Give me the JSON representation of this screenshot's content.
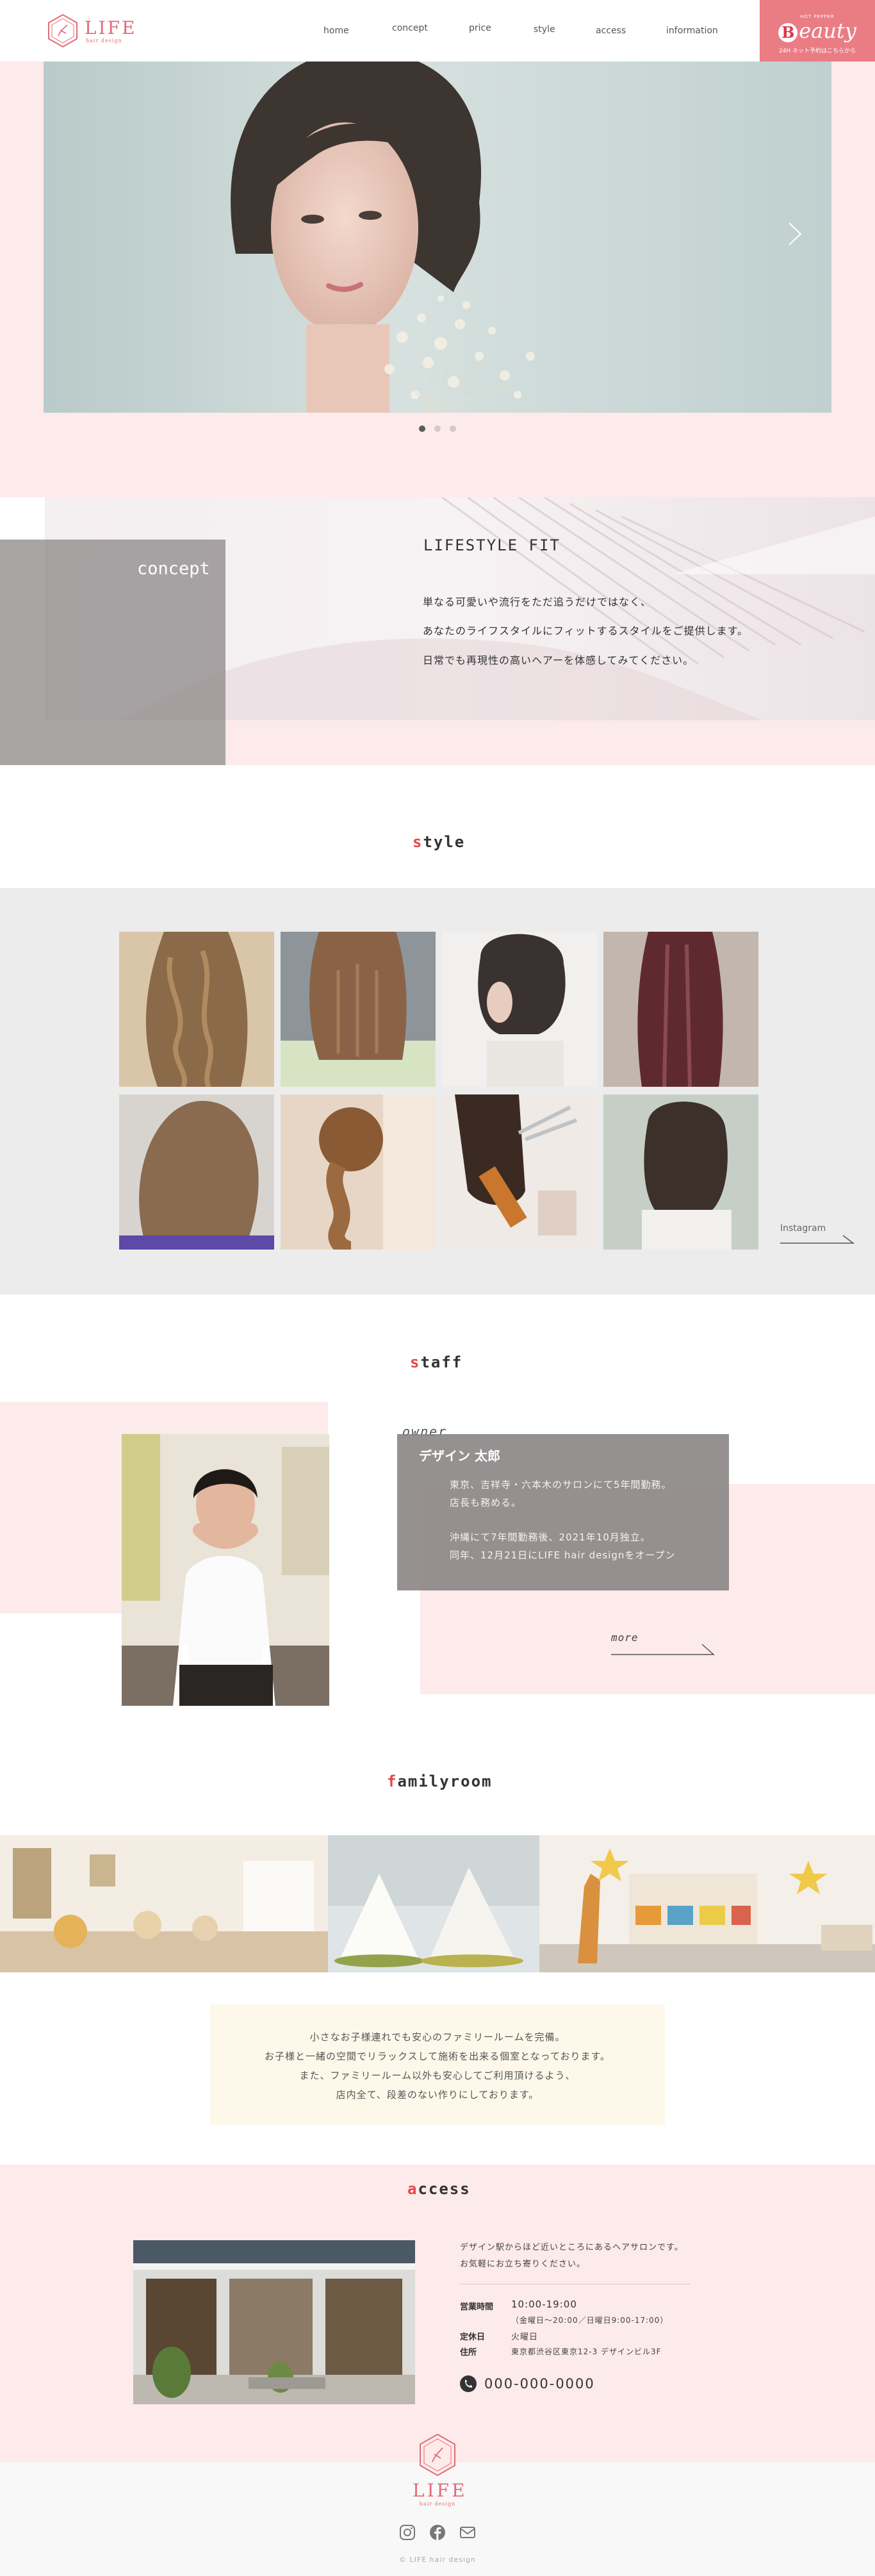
{
  "header": {
    "brand": "LIFE",
    "brand_sub": "hair design",
    "nav": [
      "home",
      "concept",
      "price",
      "style",
      "access",
      "information"
    ],
    "beauty_top": "HOT PEPPER",
    "beauty_label": "eauty",
    "beauty_letter": "B",
    "beauty_sub": "24H ネット予約はこちらから"
  },
  "hero": {
    "slide_count": 3,
    "active_slide": 1
  },
  "concept": {
    "label": "concept",
    "heading": "LIFESTYLE FIT",
    "lines": [
      "単なる可愛いや流行をただ追うだけではなく、",
      "あなたのライフスタイルにフィットするスタイルをご提供します。",
      "日常でも再現性の高いヘアーを体感してみてください。"
    ]
  },
  "style": {
    "title_accent": "s",
    "title_rest": "tyle",
    "instagram": "Instagram"
  },
  "staff": {
    "title_accent": "s",
    "title_rest": "taff",
    "role": "owner",
    "name": "デザイン 太郎",
    "lines": [
      "東京、吉祥寺・六本木のサロンにて5年間勤務。",
      "店長も務める。",
      "",
      "沖縄にて7年間勤務後、2021年10月独立。",
      "同年、12月21日にLIFE hair designをオープン"
    ],
    "more": "more"
  },
  "familyroom": {
    "title_accent": "f",
    "title_rest": "amilyroom",
    "lines": [
      "小さなお子様連れでも安心のファミリールームを完備。",
      "お子様と一緒の空間でリラックスして施術を出来る個室となっております。",
      "また、ファミリールーム以外も安心してご利用頂けるよう、",
      "店内全て、段差のない作りにしております。"
    ]
  },
  "access": {
    "title_accent": "a",
    "title_rest": "ccess",
    "intro": [
      "デザイン駅からほど近いところにあるヘアサロンです。",
      "お気軽にお立ち寄りください。"
    ],
    "hours_label": "営業時間",
    "hours": "10:00-19:00",
    "hours_note": "（金曜日～20:00／日曜日9:00-17:00）",
    "closed_label": "定休日",
    "closed": "火曜日",
    "address_label": "住所",
    "address": "東京都渋谷区東京12-3 デザインビル3F",
    "phone": "000-000-0000"
  },
  "footer": {
    "brand": "LIFE",
    "brand_sub": "hair design",
    "social": [
      "instagram-icon",
      "facebook-icon",
      "mail-icon"
    ],
    "copyright": "© LIFE hair design"
  },
  "colors": {
    "accent": "#e5484d",
    "brand_pink": "#e06c78",
    "soft_pink": "#fdeaea",
    "beauty_pink": "#ea7c84"
  }
}
